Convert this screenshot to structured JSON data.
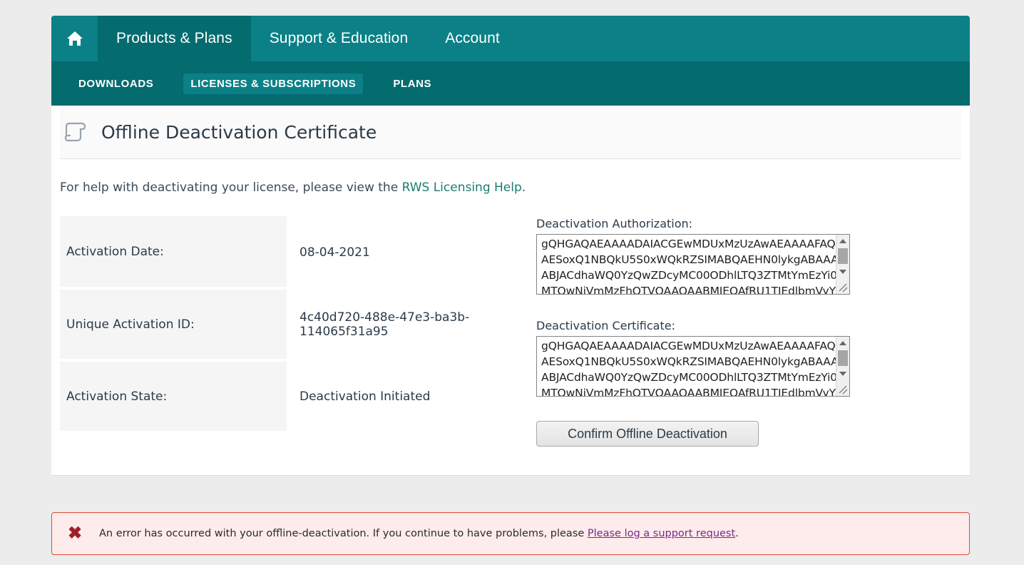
{
  "topnav": {
    "home_icon": "home-icon",
    "tabs": [
      {
        "label": "Products & Plans",
        "active": true
      },
      {
        "label": "Support & Education",
        "active": false
      },
      {
        "label": "Account",
        "active": false
      }
    ]
  },
  "subnav": {
    "items": [
      {
        "label": "DOWNLOADS",
        "active": false
      },
      {
        "label": "LICENSES & SUBSCRIPTIONS",
        "active": true
      },
      {
        "label": "PLANS",
        "active": false
      }
    ]
  },
  "page": {
    "icon": "scroll-certificate-icon",
    "title": "Offline Deactivation Certificate",
    "help_prefix": "For help with deactivating your license, please view the ",
    "help_link": "RWS Licensing Help",
    "help_suffix": "."
  },
  "info": {
    "rows": [
      {
        "label": "Activation Date:",
        "value": "08-04-2021"
      },
      {
        "label": "Unique Activation ID:",
        "value": "4c40d720-488e-47e3-ba3b-114065f31a95"
      },
      {
        "label": "Activation State:",
        "value": "Deactivation Initiated"
      }
    ]
  },
  "authorization": {
    "label": "Deactivation Authorization:",
    "value": "gQHGAQAEAAAADAIACGEwMDUxMzUzAwAEAAAAFAQ\nAESoxQ1NBQkU5S0xWQkRZSIMABQAEHN0lykgABAAAA\nABJACdhaWQ0YzQwZDcyMC00ODhlLTQ3ZTMtYmEzYi0x\nMTQwNjVmMzFhOTVQAAQAABMJEQAfRU1TIEdlbmVyYX\nRIZQBQQZYJkuXNLWQJFDcY9lLHEPI8EAMUILAQxxDQBQ"
  },
  "certificate": {
    "label": "Deactivation Certificate:",
    "value": "gQHGAQAEAAAADAIACGEwMDUxMzUzAwAEAAAAFAQ\nAESoxQ1NBQkU5S0xWQkRZSIMABQAEHN0lykgABAAAA\nABJACdhaWQ0YzQwZDcyMC00ODhlLTQ3ZTMtYmEzYi0x\nMTQwNjVmMzFhOTVQAAQAABMJEQAfRU1TIEdlbmVyYX\nRIZQBQQZYJkuXNLWQJFDcY9lLHEPI8EAMUILAQxxDQBQ"
  },
  "confirm_button": {
    "label": "Confirm Offline Deactivation"
  },
  "error": {
    "icon": "error-x-icon",
    "text_prefix": "An error has occurred with your offline-deactivation. If you continue to have problems, please ",
    "link": "Please log a support request",
    "text_suffix": "."
  },
  "colors": {
    "brand_teal": "#0b8086",
    "brand_teal_dark": "#046b6e",
    "link_teal": "#1c7c74",
    "error_border": "#e04a36",
    "error_bg": "#fdeceb",
    "error_icon": "#a01e28",
    "error_link": "#7a2a8a",
    "page_bg": "#ececec"
  }
}
